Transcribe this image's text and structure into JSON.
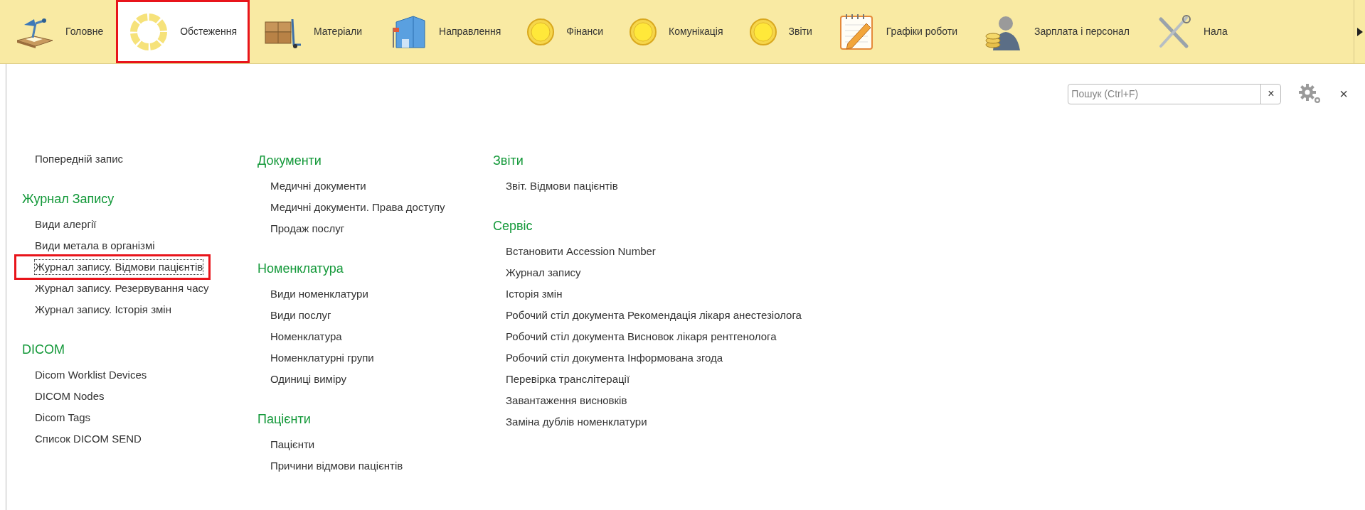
{
  "sections": [
    {
      "label": "Головне",
      "selected": false,
      "highlighted": false
    },
    {
      "label": "Обстеження",
      "selected": true,
      "highlighted": true
    },
    {
      "label": "Матеріали",
      "selected": false,
      "highlighted": false
    },
    {
      "label": "Направлення",
      "selected": false,
      "highlighted": false
    },
    {
      "label": "Фінанси",
      "selected": false,
      "highlighted": false
    },
    {
      "label": "Комунікація",
      "selected": false,
      "highlighted": false
    },
    {
      "label": "Звіти",
      "selected": false,
      "highlighted": false
    },
    {
      "label": "Графіки роботи",
      "selected": false,
      "highlighted": false
    },
    {
      "label": "Зарплата і персонал",
      "selected": false,
      "highlighted": false
    },
    {
      "label": "Нала",
      "selected": false,
      "highlighted": false
    }
  ],
  "search": {
    "placeholder": "Пошук (Ctrl+F)",
    "clear": "×"
  },
  "close": "×",
  "columns": [
    [
      {
        "items": [
          {
            "label": "Попередній запис",
            "focused": false,
            "highlighted": false
          }
        ]
      },
      {
        "title": "Журнал Запису",
        "items": [
          {
            "label": "Види алергії",
            "focused": false,
            "highlighted": false
          },
          {
            "label": "Види метала в організмі",
            "focused": false,
            "highlighted": false
          },
          {
            "label": "Журнал запису. Відмови пацієнтів",
            "focused": true,
            "highlighted": true
          },
          {
            "label": "Журнал запису. Резервування часу",
            "focused": false,
            "highlighted": false
          },
          {
            "label": "Журнал запису. Історія змін",
            "focused": false,
            "highlighted": false
          }
        ]
      },
      {
        "title": "DICOM",
        "items": [
          {
            "label": "Dicom Worklist Devices",
            "focused": false,
            "highlighted": false
          },
          {
            "label": "DICOM Nodes",
            "focused": false,
            "highlighted": false
          },
          {
            "label": "Dicom Tags",
            "focused": false,
            "highlighted": false
          },
          {
            "label": "Список DICOM SEND",
            "focused": false,
            "highlighted": false
          }
        ]
      }
    ],
    [
      {
        "title": "Документи",
        "items": [
          {
            "label": "Медичні документи",
            "focused": false,
            "highlighted": false
          },
          {
            "label": "Медичні документи. Права доступу",
            "focused": false,
            "highlighted": false
          },
          {
            "label": "Продаж послуг",
            "focused": false,
            "highlighted": false
          }
        ]
      },
      {
        "title": "Номенклатура",
        "items": [
          {
            "label": "Види номенклатури",
            "focused": false,
            "highlighted": false
          },
          {
            "label": "Види послуг",
            "focused": false,
            "highlighted": false
          },
          {
            "label": "Номенклатура",
            "focused": false,
            "highlighted": false
          },
          {
            "label": "Номенклатурні групи",
            "focused": false,
            "highlighted": false
          },
          {
            "label": "Одиниці виміру",
            "focused": false,
            "highlighted": false
          }
        ]
      },
      {
        "title": "Пацієнти",
        "items": [
          {
            "label": "Пацієнти",
            "focused": false,
            "highlighted": false
          },
          {
            "label": "Причини відмови пацієнтів",
            "focused": false,
            "highlighted": false
          }
        ]
      }
    ],
    [
      {
        "title": "Звіти",
        "items": [
          {
            "label": "Звіт. Відмови пацієнтів",
            "focused": false,
            "highlighted": false
          }
        ]
      },
      {
        "title": "Сервіс",
        "items": [
          {
            "label": "Встановити Accession Number",
            "focused": false,
            "highlighted": false
          },
          {
            "label": "Журнал запису",
            "focused": false,
            "highlighted": false
          },
          {
            "label": "Історія змін",
            "focused": false,
            "highlighted": false
          },
          {
            "label": "Робочий стіл документа Рекомендація лікаря анестезіолога",
            "focused": false,
            "highlighted": false
          },
          {
            "label": "Робочий стіл документа Висновок лікаря рентгенолога",
            "focused": false,
            "highlighted": false
          },
          {
            "label": "Робочий стіл документа Інформована згода",
            "focused": false,
            "highlighted": false
          },
          {
            "label": "Перевірка транслітерації",
            "focused": false,
            "highlighted": false
          },
          {
            "label": "Завантаження висновків",
            "focused": false,
            "highlighted": false
          },
          {
            "label": "Заміна дублів номенклатури",
            "focused": false,
            "highlighted": false
          }
        ]
      }
    ]
  ]
}
